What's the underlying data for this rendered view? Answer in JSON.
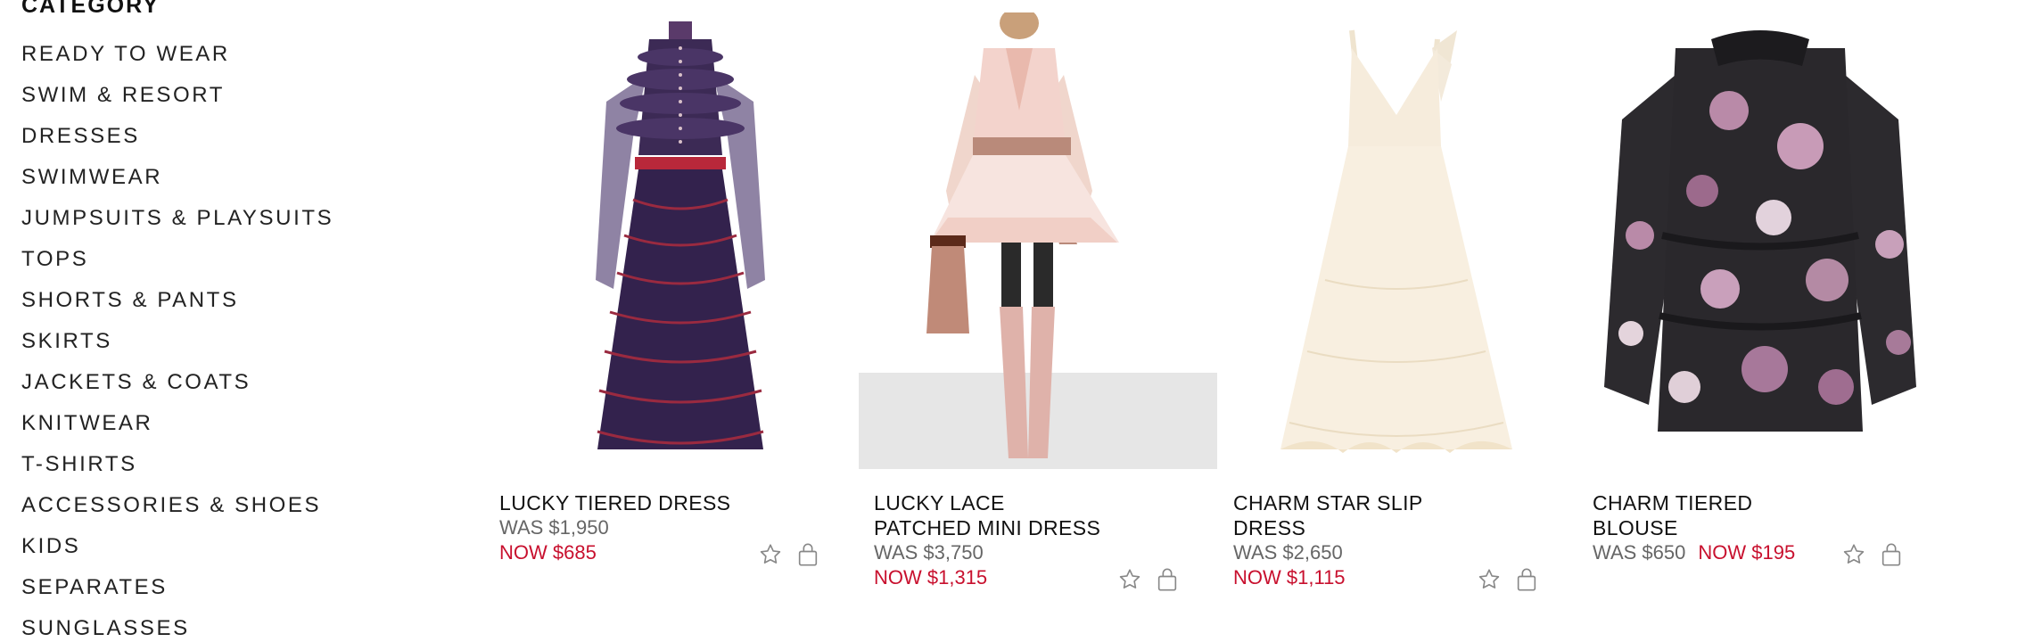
{
  "sidebar": {
    "title": "CATEGORY",
    "items": [
      {
        "label": "READY TO WEAR"
      },
      {
        "label": "SWIM & RESORT"
      },
      {
        "label": "DRESSES"
      },
      {
        "label": "SWIMWEAR"
      },
      {
        "label": "JUMPSUITS & PLAYSUITS"
      },
      {
        "label": "TOPS"
      },
      {
        "label": "SHORTS & PANTS"
      },
      {
        "label": "SKIRTS"
      },
      {
        "label": "JACKETS & COATS"
      },
      {
        "label": "KNITWEAR"
      },
      {
        "label": "T-SHIRTS"
      },
      {
        "label": "ACCESSORIES & SHOES"
      },
      {
        "label": "KIDS"
      },
      {
        "label": "SEPARATES"
      },
      {
        "label": "SUNGLASSES"
      }
    ]
  },
  "products": [
    {
      "name_line1": "LUCKY TIERED DRESS",
      "name_line2": "",
      "was": "WAS $1,950",
      "now": "NOW $685"
    },
    {
      "name_line1": "LUCKY LACE",
      "name_line2": "PATCHED MINI DRESS",
      "was": "WAS $3,750",
      "now": "NOW $1,315"
    },
    {
      "name_line1": "CHARM STAR SLIP",
      "name_line2": "DRESS",
      "was": "WAS $2,650",
      "now": "NOW $1,115"
    },
    {
      "name_line1": "CHARM TIERED",
      "name_line2": "BLOUSE",
      "was": "WAS $650",
      "now": "NOW $195"
    }
  ],
  "icons": {
    "wishlist": "star-outline-icon",
    "bag": "shopping-bag-outline-icon"
  },
  "colors": {
    "sale_red": "#c8102e",
    "was_gray": "#666666",
    "text": "#111111"
  }
}
